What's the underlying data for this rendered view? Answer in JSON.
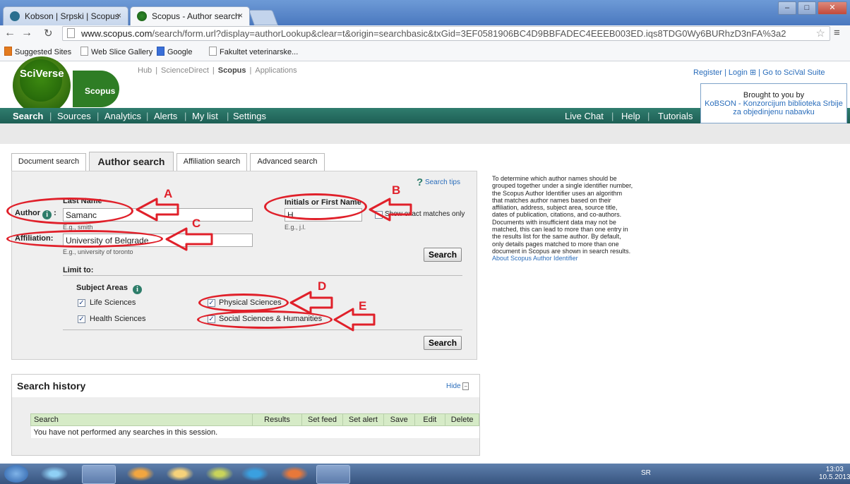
{
  "browser": {
    "tabs": [
      {
        "title": "Kobson | Srpski | Scopus",
        "close": "×"
      },
      {
        "title": "Scopus - Author search",
        "close": "×"
      }
    ],
    "url_host": "www.scopus.com",
    "url_path": "/search/form.url?display=authorLookup&clear=t&origin=searchbasic&txGid=3EF0581906BC4D9BBFADEC4EEEB003ED.iqs8TDG0Wy6BURhzD3nFA%3a2",
    "bookmarks": [
      "Suggested Sites",
      "Web Slice Gallery",
      "Google",
      "Fakultet veterinarske..."
    ]
  },
  "header": {
    "logo_text": "SciVerse",
    "logo_sub": "Scopus",
    "top_links": [
      "Hub",
      "ScienceDirect",
      "Scopus",
      "Applications"
    ],
    "right_links": "Register | Login ⊞ | Go to SciVal Suite",
    "brought_by": "Brought to you by",
    "brought_org": "KoBSON - Konzorcijum biblioteka Srbije za objedinjenu nabavku"
  },
  "nav": {
    "left": [
      "Search",
      "Sources",
      "Analytics",
      "Alerts",
      "My list",
      "Settings"
    ],
    "right": [
      "Live Chat",
      "Help",
      "Tutorials"
    ]
  },
  "search_tabs": [
    "Document search",
    "Author search",
    "Affiliation search",
    "Advanced search"
  ],
  "form": {
    "search_tips": "Search tips",
    "author_label": "Author",
    "last_name_label": "Last Name",
    "last_name_value": "Samanc",
    "last_name_hint": "E.g., smith",
    "first_name_label": "Initials or First Name",
    "first_name_value": "H",
    "first_name_hint": "E.g., j.l.",
    "exact_match_label": "Show exact matches only",
    "affiliation_label": "Affiliation:",
    "affiliation_value": "University of Belgrade",
    "affiliation_hint": "E.g., university of toronto",
    "search_button": "Search",
    "limit_to": "Limit to:",
    "subject_areas": "Subject Areas",
    "subjects": [
      {
        "label": "Life Sciences",
        "checked": true
      },
      {
        "label": "Health Sciences",
        "checked": true
      },
      {
        "label": "Physical Sciences",
        "checked": true
      },
      {
        "label": "Social Sciences & Humanities",
        "checked": true
      }
    ]
  },
  "right_desc": {
    "text": "To determine which author names should be grouped together under a single identifier number, the Scopus Author Identifier uses an algorithm that matches author names based on their affiliation, address, subject area, source title, dates of publication, citations, and co-authors. Documents with insufficient data may not be matched, this can lead to more than one entry in the results list for the same author. By default, only details pages matched to more than one document in Scopus are shown in search results.",
    "link": "About Scopus Author Identifier"
  },
  "history": {
    "title": "Search history",
    "hide": "Hide",
    "columns": [
      "Search",
      "Results",
      "Set feed",
      "Set alert",
      "Save",
      "Edit",
      "Delete"
    ],
    "empty": "You have not performed any searches in this session."
  },
  "annotations": [
    "A",
    "B",
    "C",
    "D",
    "E"
  ],
  "taskbar": {
    "lang": "SR",
    "time": "13:03",
    "date": "10.5.2013"
  },
  "colors": {
    "nav_green": "#2f7d6e",
    "annotation_red": "#e0202a",
    "link_blue": "#2a6dbb"
  }
}
